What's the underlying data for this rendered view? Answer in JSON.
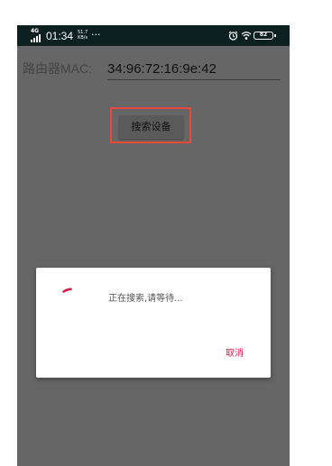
{
  "status_bar": {
    "network_type": "4G",
    "time": "01:34",
    "speed_value": "51.7",
    "speed_unit": "KB/s",
    "more_indicator": "···",
    "battery_level": "82",
    "icons": [
      "signal-icon",
      "alarm-icon",
      "wifi-icon",
      "battery-icon"
    ]
  },
  "form": {
    "mac_label": "路由器MAC:",
    "mac_value": "34:96:72:16:9e:42"
  },
  "search_button": {
    "label": "搜索设备"
  },
  "dialog": {
    "message": "正在搜索,请等待...",
    "cancel_label": "取消"
  },
  "colors": {
    "overlay": "#666666",
    "status_bar": "#0c2020",
    "highlight_border": "#e8483a",
    "accent": "#d81b4a"
  }
}
